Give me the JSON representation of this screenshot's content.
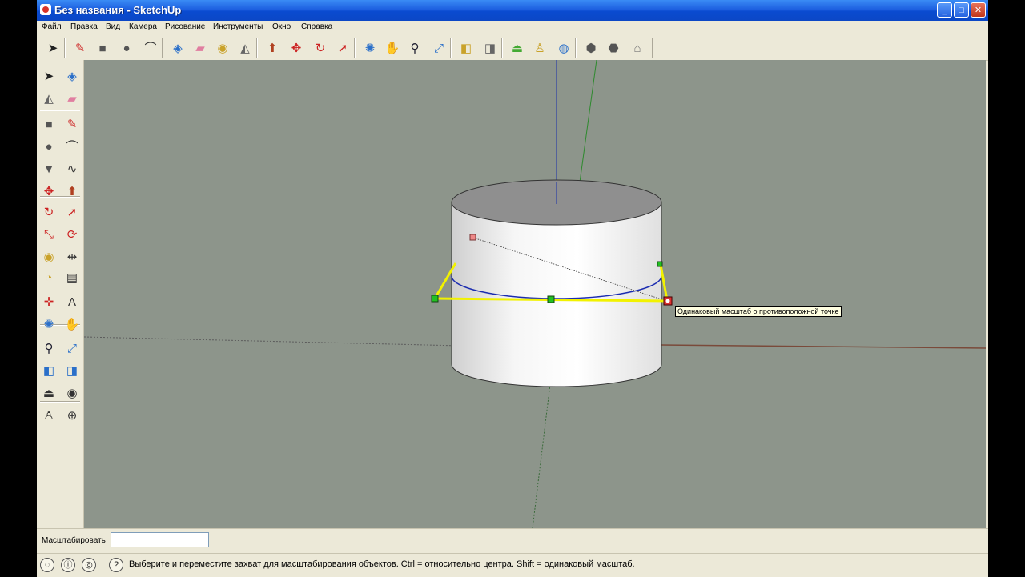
{
  "window": {
    "title": "Без названия - SketchUp"
  },
  "menu": [
    "Файл",
    "Правка",
    "Вид",
    "Камера",
    "Рисование",
    "Инструменты",
    "Окно",
    "Справка"
  ],
  "toolbar": {
    "tools": [
      {
        "name": "select-icon",
        "glyph": "➤",
        "color": "#222"
      },
      {
        "name": "pencil-icon",
        "glyph": "✎",
        "color": "#c22"
      },
      {
        "name": "rectangle-icon",
        "glyph": "■",
        "color": "#555"
      },
      {
        "name": "circle-icon",
        "glyph": "●",
        "color": "#555"
      },
      {
        "name": "arc-icon",
        "glyph": "⌒",
        "color": "#333"
      },
      {
        "name": "make-component-icon",
        "glyph": "◈",
        "color": "#2a6fc9"
      },
      {
        "name": "eraser-icon",
        "glyph": "▰",
        "color": "#e07ea0"
      },
      {
        "name": "tape-measure-icon",
        "glyph": "◉",
        "color": "#c9a22a"
      },
      {
        "name": "paint-bucket-icon",
        "glyph": "◭",
        "color": "#666"
      },
      {
        "name": "push-pull-icon",
        "glyph": "⬆",
        "color": "#b04020"
      },
      {
        "name": "move-icon",
        "glyph": "✥",
        "color": "#c22"
      },
      {
        "name": "rotate-icon",
        "glyph": "↻",
        "color": "#c22"
      },
      {
        "name": "follow-me-icon",
        "glyph": "➚",
        "color": "#c22"
      },
      {
        "name": "orbit-icon",
        "glyph": "✺",
        "color": "#2a6fc9"
      },
      {
        "name": "pan-icon",
        "glyph": "✋",
        "color": "#444"
      },
      {
        "name": "zoom-icon",
        "glyph": "⚲",
        "color": "#223"
      },
      {
        "name": "zoom-extents-icon",
        "glyph": "⤢",
        "color": "#2a6fc9"
      },
      {
        "name": "previous-view-icon",
        "glyph": "◧",
        "color": "#c9a22a"
      },
      {
        "name": "next-view-icon",
        "glyph": "◨",
        "color": "#666"
      },
      {
        "name": "position-camera-icon",
        "glyph": "⏏",
        "color": "#4a3"
      },
      {
        "name": "walk-icon",
        "glyph": "♙",
        "color": "#c9a22a"
      },
      {
        "name": "google-earth-icon",
        "glyph": "◍",
        "color": "#2a6fc9"
      },
      {
        "name": "get-models-icon",
        "glyph": "⬢",
        "color": "#555"
      },
      {
        "name": "share-model-icon",
        "glyph": "⬣",
        "color": "#555"
      },
      {
        "name": "warehouse-icon",
        "glyph": "⌂",
        "color": "#777"
      }
    ]
  },
  "left_toolbar": {
    "tools": [
      {
        "name": "select-icon",
        "glyph": "➤",
        "color": "#222"
      },
      {
        "name": "make-component-icon",
        "glyph": "◈",
        "color": "#2a6fc9"
      },
      {
        "name": "paint-bucket-icon",
        "glyph": "◭",
        "color": "#666"
      },
      {
        "name": "eraser-icon",
        "glyph": "▰",
        "color": "#e07ea0"
      },
      {
        "name": "rectangle-icon",
        "glyph": "■",
        "color": "#555"
      },
      {
        "name": "line-icon",
        "glyph": "✎",
        "color": "#c22"
      },
      {
        "name": "circle-icon",
        "glyph": "●",
        "color": "#555"
      },
      {
        "name": "arc-icon",
        "glyph": "⌒",
        "color": "#333"
      },
      {
        "name": "polygon-icon",
        "glyph": "▼",
        "color": "#555"
      },
      {
        "name": "freehand-icon",
        "glyph": "∿",
        "color": "#333"
      },
      {
        "name": "move-icon",
        "glyph": "✥",
        "color": "#c22"
      },
      {
        "name": "push-pull-icon",
        "glyph": "⬆",
        "color": "#b04020"
      },
      {
        "name": "rotate-icon",
        "glyph": "↻",
        "color": "#c22"
      },
      {
        "name": "follow-me-icon",
        "glyph": "➚",
        "color": "#c22"
      },
      {
        "name": "scale-icon",
        "glyph": "⤡",
        "color": "#c22"
      },
      {
        "name": "offset-icon",
        "glyph": "⟳",
        "color": "#c22"
      },
      {
        "name": "tape-measure-icon",
        "glyph": "◉",
        "color": "#c9a22a"
      },
      {
        "name": "dimension-icon",
        "glyph": "⇹",
        "color": "#333"
      },
      {
        "name": "protractor-icon",
        "glyph": "◔",
        "color": "#c9a22a"
      },
      {
        "name": "text-icon",
        "glyph": "▤",
        "color": "#333"
      },
      {
        "name": "axes-icon",
        "glyph": "✛",
        "color": "#c22"
      },
      {
        "name": "3d-text-icon",
        "glyph": "A",
        "color": "#333"
      },
      {
        "name": "orbit-icon",
        "glyph": "✺",
        "color": "#2a6fc9"
      },
      {
        "name": "pan-icon",
        "glyph": "✋",
        "color": "#444"
      },
      {
        "name": "zoom-icon",
        "glyph": "⚲",
        "color": "#223"
      },
      {
        "name": "zoom-extents-icon",
        "glyph": "⤢",
        "color": "#2a6fc9"
      },
      {
        "name": "previous-view-icon",
        "glyph": "◧",
        "color": "#2a6fc9"
      },
      {
        "name": "next-view-icon",
        "glyph": "◨",
        "color": "#2a6fc9"
      },
      {
        "name": "position-camera-icon",
        "glyph": "⏏",
        "color": "#333"
      },
      {
        "name": "look-around-icon",
        "glyph": "◉",
        "color": "#333"
      },
      {
        "name": "walk-icon",
        "glyph": "♙",
        "color": "#222"
      },
      {
        "name": "section-plane-icon",
        "glyph": "⊕",
        "color": "#333"
      }
    ]
  },
  "viewport": {
    "background": "#8d958b",
    "tooltip": "Одинаковый масштаб о противоположной точке"
  },
  "vcb": {
    "label": "Масштабировать",
    "value": ""
  },
  "status": {
    "icons": [
      "info-icon",
      "credits-icon",
      "user-icon"
    ],
    "help_icon": "?",
    "text": "Выберите и переместите захват для масштабирования объектов. Ctrl = относительно центра. Shift = одинаковый масштаб."
  }
}
